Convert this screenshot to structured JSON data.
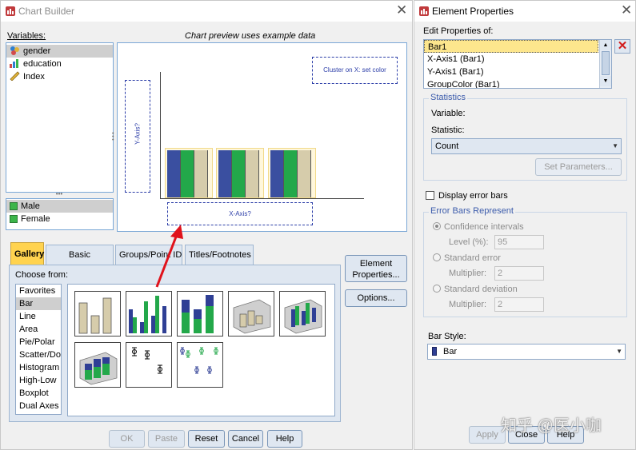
{
  "chart_builder": {
    "title": "Chart Builder",
    "variables_label": "Variables:",
    "preview_caption": "Chart preview uses example data",
    "variables": [
      {
        "name": "gender",
        "icon": "nominal-variable-icon",
        "selected": true
      },
      {
        "name": "education",
        "icon": "ordinal-variable-icon",
        "selected": false
      },
      {
        "name": "Index",
        "icon": "scale-variable-icon",
        "selected": false
      }
    ],
    "categories": [
      {
        "name": "Male",
        "selected": true
      },
      {
        "name": "Female",
        "selected": false
      }
    ],
    "drop_zones": {
      "cluster": "Cluster on X: set color",
      "y_axis": "Y-Axis?",
      "x_axis": "X-Axis?"
    },
    "tabs": [
      {
        "label": "Gallery",
        "active": true
      },
      {
        "label": "Basic Elements",
        "active": false
      },
      {
        "label": "Groups/Point ID",
        "active": false
      },
      {
        "label": "Titles/Footnotes",
        "active": false
      }
    ],
    "choose_from_label": "Choose from:",
    "chart_types": [
      {
        "label": "Favorites",
        "selected": false
      },
      {
        "label": "Bar",
        "selected": true
      },
      {
        "label": "Line",
        "selected": false
      },
      {
        "label": "Area",
        "selected": false
      },
      {
        "label": "Pie/Polar",
        "selected": false
      },
      {
        "label": "Scatter/Dot",
        "selected": false
      },
      {
        "label": "Histogram",
        "selected": false
      },
      {
        "label": "High-Low",
        "selected": false
      },
      {
        "label": "Boxplot",
        "selected": false
      },
      {
        "label": "Dual Axes",
        "selected": false
      }
    ],
    "gallery_thumbnails": [
      "simple-bar-icon",
      "clustered-bar-icon",
      "stacked-bar-icon",
      "3d-bar-icon",
      "3d-clustered-bar-icon",
      "3d-stacked-bar-icon",
      "error-bar-icon",
      "clustered-error-bar-icon"
    ],
    "side_buttons": {
      "element_properties": "Element\nProperties...",
      "options": "Options..."
    },
    "bottom_buttons": [
      {
        "label": "OK",
        "enabled": false
      },
      {
        "label": "Paste",
        "enabled": false
      },
      {
        "label": "Reset",
        "enabled": true
      },
      {
        "label": "Cancel",
        "enabled": true
      },
      {
        "label": "Help",
        "enabled": true
      }
    ],
    "preview_colors": {
      "blue": "#3a4fa0",
      "green": "#23a84a",
      "tan": "#d6ccab"
    }
  },
  "element_properties": {
    "title": "Element Properties",
    "edit_label": "Edit Properties of:",
    "elements": [
      {
        "label": "Bar1",
        "selected": true
      },
      {
        "label": "X-Axis1 (Bar1)",
        "selected": false
      },
      {
        "label": "Y-Axis1 (Bar1)",
        "selected": false
      },
      {
        "label": "GroupColor (Bar1)",
        "selected": false
      }
    ],
    "statistics": {
      "group_label": "Statistics",
      "variable_label": "Variable:",
      "statistic_label": "Statistic:",
      "statistic_value": "Count",
      "set_parameters": "Set Parameters..."
    },
    "display_error_bars": "Display error bars",
    "error_bars": {
      "group_label": "Error Bars Represent",
      "confidence": "Confidence intervals",
      "level_label": "Level (%):",
      "level_value": "95",
      "standard_error": "Standard error",
      "se_multiplier_label": "Multiplier:",
      "se_multiplier_value": "2",
      "standard_deviation": "Standard deviation",
      "sd_multiplier_label": "Multiplier:",
      "sd_multiplier_value": "2"
    },
    "bar_style_label": "Bar Style:",
    "bar_style_value": "Bar",
    "buttons": [
      {
        "label": "Apply",
        "enabled": false
      },
      {
        "label": "Close",
        "enabled": true
      },
      {
        "label": "Help",
        "enabled": true
      }
    ]
  },
  "watermark": "知乎 @医小咖",
  "accent_color": "#ffd34f",
  "arrow_color": "#e0121b"
}
